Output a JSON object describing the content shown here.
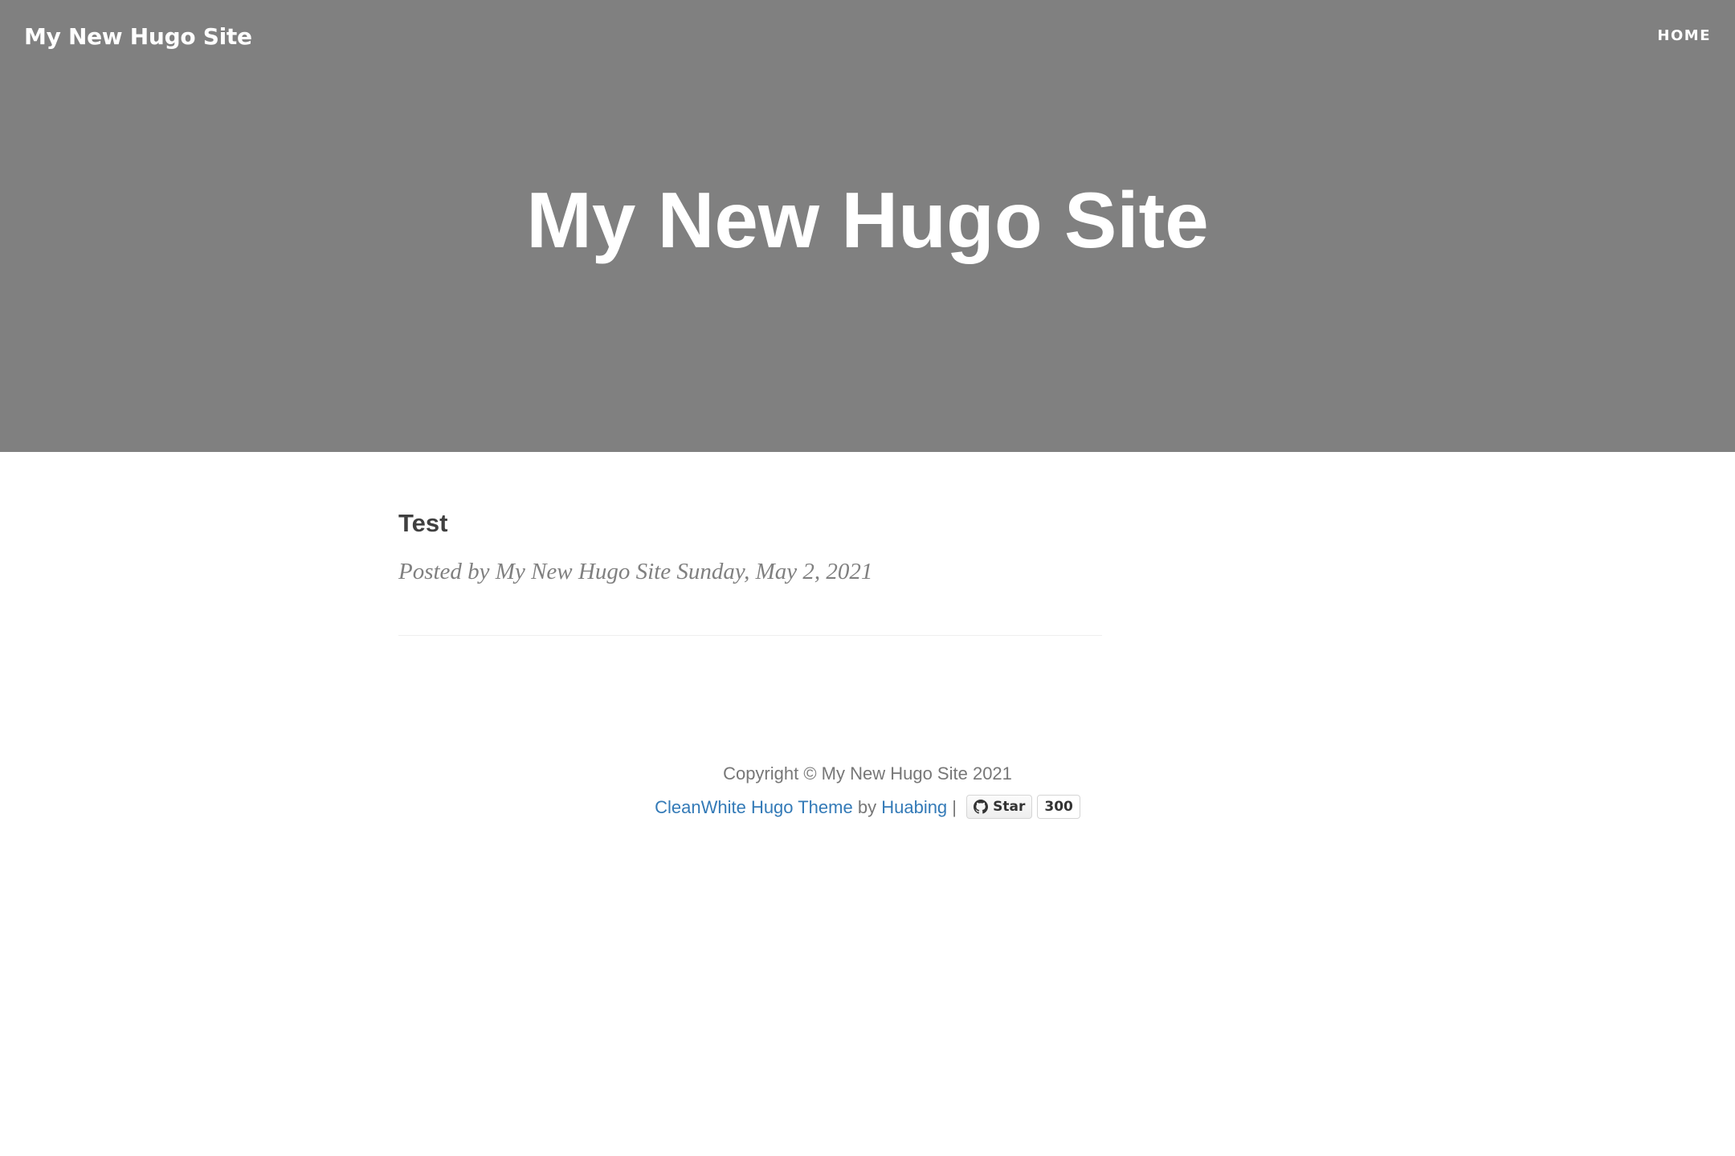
{
  "navbar": {
    "brand": "My New Hugo Site",
    "items": [
      {
        "label": "HOME"
      }
    ]
  },
  "hero": {
    "title": "My New Hugo Site"
  },
  "posts": [
    {
      "title": "Test",
      "meta": "Posted by My New Hugo Site Sunday, May 2, 2021"
    }
  ],
  "footer": {
    "copyright": "Copyright © My New Hugo Site 2021",
    "theme_link": "CleanWhite Hugo Theme",
    "by": "by",
    "author_link": "Huabing",
    "separator": "|",
    "github": {
      "star_label": "Star",
      "star_count": "300",
      "icon": "github-icon"
    }
  },
  "colors": {
    "hero_background": "#808080",
    "link": "#337ab7",
    "meta_text": "#808080",
    "body_text": "#404040"
  }
}
